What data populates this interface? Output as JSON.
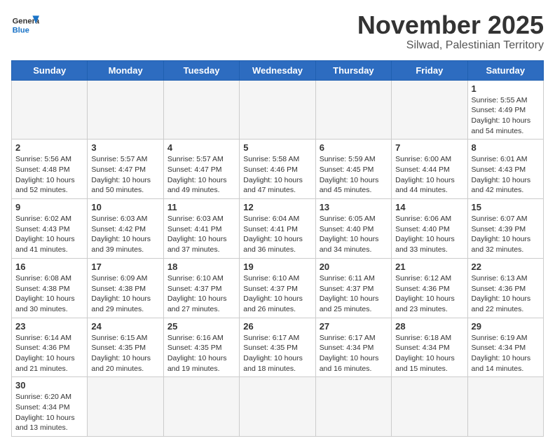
{
  "header": {
    "logo_general": "General",
    "logo_blue": "Blue",
    "month_title": "November 2025",
    "location": "Silwad, Palestinian Territory"
  },
  "days_of_week": [
    "Sunday",
    "Monday",
    "Tuesday",
    "Wednesday",
    "Thursday",
    "Friday",
    "Saturday"
  ],
  "weeks": [
    [
      {
        "day": "",
        "info": ""
      },
      {
        "day": "",
        "info": ""
      },
      {
        "day": "",
        "info": ""
      },
      {
        "day": "",
        "info": ""
      },
      {
        "day": "",
        "info": ""
      },
      {
        "day": "",
        "info": ""
      },
      {
        "day": "1",
        "info": "Sunrise: 5:55 AM\nSunset: 4:49 PM\nDaylight: 10 hours\nand 54 minutes."
      }
    ],
    [
      {
        "day": "2",
        "info": "Sunrise: 5:56 AM\nSunset: 4:48 PM\nDaylight: 10 hours\nand 52 minutes."
      },
      {
        "day": "3",
        "info": "Sunrise: 5:57 AM\nSunset: 4:47 PM\nDaylight: 10 hours\nand 50 minutes."
      },
      {
        "day": "4",
        "info": "Sunrise: 5:57 AM\nSunset: 4:47 PM\nDaylight: 10 hours\nand 49 minutes."
      },
      {
        "day": "5",
        "info": "Sunrise: 5:58 AM\nSunset: 4:46 PM\nDaylight: 10 hours\nand 47 minutes."
      },
      {
        "day": "6",
        "info": "Sunrise: 5:59 AM\nSunset: 4:45 PM\nDaylight: 10 hours\nand 45 minutes."
      },
      {
        "day": "7",
        "info": "Sunrise: 6:00 AM\nSunset: 4:44 PM\nDaylight: 10 hours\nand 44 minutes."
      },
      {
        "day": "8",
        "info": "Sunrise: 6:01 AM\nSunset: 4:43 PM\nDaylight: 10 hours\nand 42 minutes."
      }
    ],
    [
      {
        "day": "9",
        "info": "Sunrise: 6:02 AM\nSunset: 4:43 PM\nDaylight: 10 hours\nand 41 minutes."
      },
      {
        "day": "10",
        "info": "Sunrise: 6:03 AM\nSunset: 4:42 PM\nDaylight: 10 hours\nand 39 minutes."
      },
      {
        "day": "11",
        "info": "Sunrise: 6:03 AM\nSunset: 4:41 PM\nDaylight: 10 hours\nand 37 minutes."
      },
      {
        "day": "12",
        "info": "Sunrise: 6:04 AM\nSunset: 4:41 PM\nDaylight: 10 hours\nand 36 minutes."
      },
      {
        "day": "13",
        "info": "Sunrise: 6:05 AM\nSunset: 4:40 PM\nDaylight: 10 hours\nand 34 minutes."
      },
      {
        "day": "14",
        "info": "Sunrise: 6:06 AM\nSunset: 4:40 PM\nDaylight: 10 hours\nand 33 minutes."
      },
      {
        "day": "15",
        "info": "Sunrise: 6:07 AM\nSunset: 4:39 PM\nDaylight: 10 hours\nand 32 minutes."
      }
    ],
    [
      {
        "day": "16",
        "info": "Sunrise: 6:08 AM\nSunset: 4:38 PM\nDaylight: 10 hours\nand 30 minutes."
      },
      {
        "day": "17",
        "info": "Sunrise: 6:09 AM\nSunset: 4:38 PM\nDaylight: 10 hours\nand 29 minutes."
      },
      {
        "day": "18",
        "info": "Sunrise: 6:10 AM\nSunset: 4:37 PM\nDaylight: 10 hours\nand 27 minutes."
      },
      {
        "day": "19",
        "info": "Sunrise: 6:10 AM\nSunset: 4:37 PM\nDaylight: 10 hours\nand 26 minutes."
      },
      {
        "day": "20",
        "info": "Sunrise: 6:11 AM\nSunset: 4:37 PM\nDaylight: 10 hours\nand 25 minutes."
      },
      {
        "day": "21",
        "info": "Sunrise: 6:12 AM\nSunset: 4:36 PM\nDaylight: 10 hours\nand 23 minutes."
      },
      {
        "day": "22",
        "info": "Sunrise: 6:13 AM\nSunset: 4:36 PM\nDaylight: 10 hours\nand 22 minutes."
      }
    ],
    [
      {
        "day": "23",
        "info": "Sunrise: 6:14 AM\nSunset: 4:36 PM\nDaylight: 10 hours\nand 21 minutes."
      },
      {
        "day": "24",
        "info": "Sunrise: 6:15 AM\nSunset: 4:35 PM\nDaylight: 10 hours\nand 20 minutes."
      },
      {
        "day": "25",
        "info": "Sunrise: 6:16 AM\nSunset: 4:35 PM\nDaylight: 10 hours\nand 19 minutes."
      },
      {
        "day": "26",
        "info": "Sunrise: 6:17 AM\nSunset: 4:35 PM\nDaylight: 10 hours\nand 18 minutes."
      },
      {
        "day": "27",
        "info": "Sunrise: 6:17 AM\nSunset: 4:34 PM\nDaylight: 10 hours\nand 16 minutes."
      },
      {
        "day": "28",
        "info": "Sunrise: 6:18 AM\nSunset: 4:34 PM\nDaylight: 10 hours\nand 15 minutes."
      },
      {
        "day": "29",
        "info": "Sunrise: 6:19 AM\nSunset: 4:34 PM\nDaylight: 10 hours\nand 14 minutes."
      }
    ],
    [
      {
        "day": "30",
        "info": "Sunrise: 6:20 AM\nSunset: 4:34 PM\nDaylight: 10 hours\nand 13 minutes."
      },
      {
        "day": "",
        "info": ""
      },
      {
        "day": "",
        "info": ""
      },
      {
        "day": "",
        "info": ""
      },
      {
        "day": "",
        "info": ""
      },
      {
        "day": "",
        "info": ""
      },
      {
        "day": "",
        "info": ""
      }
    ]
  ]
}
